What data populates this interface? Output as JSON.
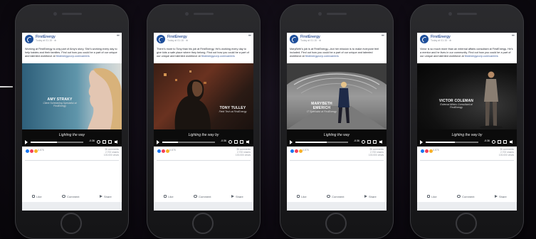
{
  "posts": [
    {
      "page_name": "FirstEnergy",
      "time": "Today at 01:15 · ⊕",
      "caption": "Working at FirstEnergy is only part of Amy's story. She's working every day to help babies and their families. Find out how you could be a part of our unique and talented workforce at",
      "link": "firstenergycorp.com/careers",
      "person_name": "AMY STRAKY",
      "person_role": "Client Scheduling Specialist at FirstEnergy",
      "tagline": "Lighting the way",
      "time_remaining": "-0:36",
      "progress": 0.5,
      "reactions_count": "6.876",
      "stat_1": "36 comments",
      "stat_2": "2.700 shares",
      "stat_3": "100.000 views",
      "actions": {
        "like": "Like",
        "comment": "Comment",
        "share": "Share"
      }
    },
    {
      "page_name": "FirstEnergy",
      "time": "Today at 01:15 · ⊕",
      "caption": "There's more to Tony than his job at FirstEnergy. He's working every day to give kids a safe place where they belong. Find out how you could be a part of our unique and talented workforce at",
      "link": "firstenergycorp.com/careers",
      "person_name": "TONY TULLEY",
      "person_role": "Field Tech at FirstEnergy",
      "tagline": "Lighting the way by",
      "time_remaining": "-0:36",
      "progress": 0.3,
      "reactions_count": "6.876",
      "stat_1": "36 comments",
      "stat_2": "2.700 shares",
      "stat_3": "100.000 views",
      "actions": {
        "like": "Like",
        "comment": "Comment",
        "share": "Share"
      }
    },
    {
      "page_name": "FirstEnergy",
      "time": "Today at 01:15 · ⊕",
      "caption": "MaryBeth's job is at FirstEnergy—but her mission is to make everyone feel included. Find out how you could be a part of our unique and talented workforce at",
      "link": "firstenergycorp.com/careers",
      "person_name": "MARYBETH EMERICH",
      "person_role": "IT Specialist at FirstEnergy",
      "tagline": "Lighting the way",
      "time_remaining": "-0:36",
      "progress": 0.6,
      "reactions_count": "6.876",
      "stat_1": "36 comments",
      "stat_2": "2.700 shares",
      "stat_3": "100.000 views",
      "actions": {
        "like": "Like",
        "comment": "Comment",
        "share": "Share"
      }
    },
    {
      "page_name": "FirstEnergy",
      "time": "Today at 01:15 · ⊕",
      "caption": "Victor is so much more than an external affairs consultant at FirstEnergy. He's a mentor and he lives in our community. Find out how you could be a part of our unique and talented workforce at",
      "link": "firstenergycorp.com/careers",
      "person_name": "VICTOR COLEMAN",
      "person_role": "External Affairs Consultant at FirstEnergy",
      "tagline": "Lighting the way by",
      "time_remaining": "-0:36",
      "progress": 0.55,
      "reactions_count": "6.876",
      "stat_1": "36 comments",
      "stat_2": "2.700 shares",
      "stat_3": "100.000 views",
      "actions": {
        "like": "Like",
        "comment": "Comment",
        "share": "Share"
      }
    }
  ],
  "colors": {
    "brand": "#1d4e9a",
    "link": "#385898",
    "background": "#0e0a12"
  }
}
